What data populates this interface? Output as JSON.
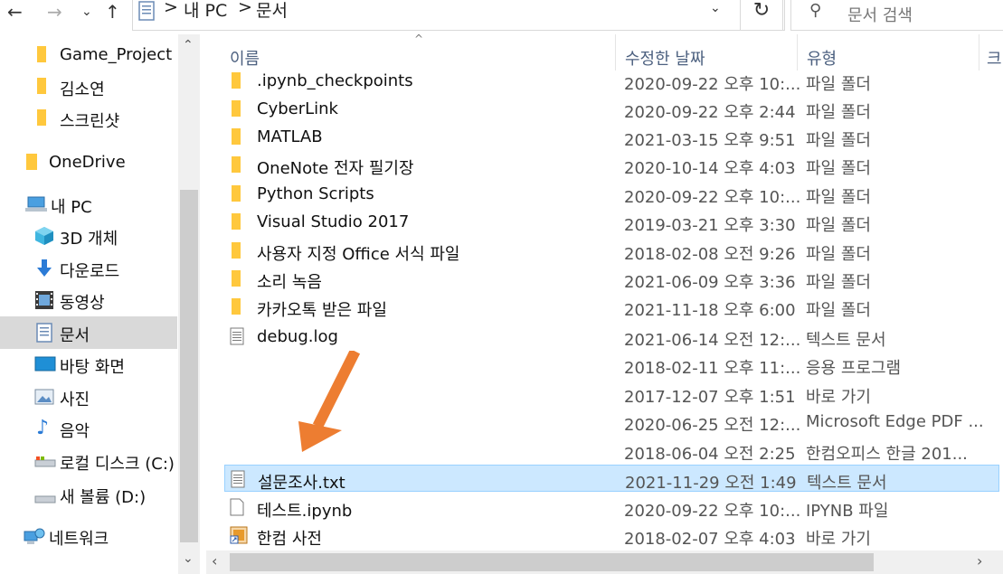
{
  "address": {
    "back": "←",
    "forward": "→",
    "recent": "⌄",
    "up": "↑",
    "crumbs": [
      "내 PC",
      "문서"
    ],
    "sep": ">",
    "dropdown": "⌄",
    "refresh": "↻",
    "search_placeholder": "문서 검색"
  },
  "sidebar": {
    "items": [
      {
        "label": "Game_Project",
        "icon": "folder-icon"
      },
      {
        "label": "김소연",
        "icon": "folder-icon"
      },
      {
        "label": "스크린샷",
        "icon": "folder-icon"
      },
      {
        "label": "OneDrive",
        "icon": "onedrive-folder-icon"
      },
      {
        "label": "내 PC",
        "icon": "pc-icon"
      },
      {
        "label": "3D 개체",
        "icon": "3d-objects-icon"
      },
      {
        "label": "다운로드",
        "icon": "download-icon"
      },
      {
        "label": "동영상",
        "icon": "video-icon"
      },
      {
        "label": "문서",
        "icon": "document-icon",
        "selected": true
      },
      {
        "label": "바탕 화면",
        "icon": "desktop-icon"
      },
      {
        "label": "사진",
        "icon": "picture-icon"
      },
      {
        "label": "음악",
        "icon": "music-icon"
      },
      {
        "label": "로컬 디스크 (C:)",
        "icon": "local-disk-icon"
      },
      {
        "label": "새 볼륨 (D:)",
        "icon": "drive-icon"
      },
      {
        "label": "네트워크",
        "icon": "network-icon"
      }
    ]
  },
  "columns": {
    "name": "이름",
    "date": "수정한 날짜",
    "type": "유형",
    "size": "크"
  },
  "files": [
    {
      "name": ".ipynb_checkpoints",
      "date": "2020-09-22 오후 10:...",
      "type": "파일 폴더",
      "icon": "folder-icon"
    },
    {
      "name": "CyberLink",
      "date": "2020-09-22 오후 2:44",
      "type": "파일 폴더",
      "icon": "folder-icon"
    },
    {
      "name": "MATLAB",
      "date": "2021-03-15 오후 9:51",
      "type": "파일 폴더",
      "icon": "folder-icon"
    },
    {
      "name": "OneNote 전자 필기장",
      "date": "2020-10-14 오후 4:03",
      "type": "파일 폴더",
      "icon": "folder-icon"
    },
    {
      "name": "Python Scripts",
      "date": "2020-09-22 오후 10:...",
      "type": "파일 폴더",
      "icon": "folder-icon"
    },
    {
      "name": "Visual Studio 2017",
      "date": "2019-03-21 오후 3:30",
      "type": "파일 폴더",
      "icon": "folder-icon"
    },
    {
      "name": "사용자 지정 Office 서식 파일",
      "date": "2018-02-08 오전 9:26",
      "type": "파일 폴더",
      "icon": "folder-icon"
    },
    {
      "name": "소리 녹음",
      "date": "2021-06-09 오후 3:36",
      "type": "파일 폴더",
      "icon": "folder-icon"
    },
    {
      "name": "카카오톡 받은 파일",
      "date": "2021-11-18 오후 6:00",
      "type": "파일 폴더",
      "icon": "folder-icon"
    },
    {
      "name": "debug.log",
      "date": "2021-06-14 오전 12:...",
      "type": "텍스트 문서",
      "icon": "text-file-icon"
    },
    {
      "name": "",
      "date": "2018-02-11 오후 11:...",
      "type": "응용 프로그램",
      "icon": ""
    },
    {
      "name": "",
      "date": "2017-12-07 오후 1:51",
      "type": "바로 가기",
      "icon": ""
    },
    {
      "name": "",
      "date": "2020-06-25 오전 12:...",
      "type": "Microsoft Edge PDF ...",
      "icon": ""
    },
    {
      "name": "",
      "date": "2018-06-04 오전 2:25",
      "type": "한컴오피스 한글 201...",
      "icon": ""
    },
    {
      "name": "설문조사.txt",
      "date": "2021-11-29 오전 1:49",
      "type": "텍스트 문서",
      "icon": "text-file-icon",
      "selected": true
    },
    {
      "name": "테스트.ipynb",
      "date": "2020-09-22 오후 10:...",
      "type": "IPYNB 파일",
      "icon": "blank-file-icon"
    },
    {
      "name": "한컴 사전",
      "date": "2018-02-07 오후 4:03",
      "type": "바로 가기",
      "icon": "shortcut-icon"
    }
  ],
  "colors": {
    "selection_bg": "#cce8ff",
    "selection_border": "#99d1ff",
    "nav_selected": "#d9d9d9",
    "folder": "#ffc83d",
    "annotation_arrow": "#ed7d31"
  }
}
